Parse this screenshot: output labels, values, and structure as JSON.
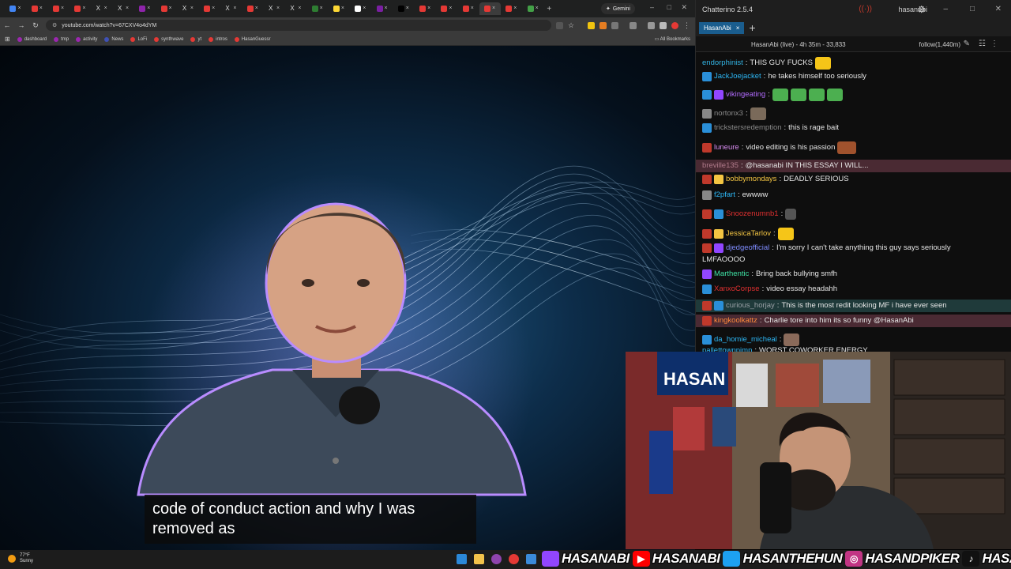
{
  "browser": {
    "tab_count": 25,
    "tabs": [
      {
        "glyph": "",
        "color": "#4285f4"
      },
      {
        "glyph": "",
        "color": "#e53935"
      },
      {
        "glyph": "",
        "color": "#e53935"
      },
      {
        "glyph": "",
        "color": "#e53935"
      },
      {
        "glyph": "X",
        "color": "#000000"
      },
      {
        "glyph": "X",
        "color": "#000000"
      },
      {
        "glyph": "",
        "color": "#8e24aa"
      },
      {
        "glyph": "",
        "color": "#e53935"
      },
      {
        "glyph": "X",
        "color": "#000000"
      },
      {
        "glyph": "",
        "color": "#e53935"
      },
      {
        "glyph": "X",
        "color": "#000000"
      },
      {
        "glyph": "",
        "color": "#e53935"
      },
      {
        "glyph": "X",
        "color": "#000000"
      },
      {
        "glyph": "X",
        "color": "#000000"
      },
      {
        "glyph": "",
        "color": "#2e7d32"
      },
      {
        "glyph": "",
        "color": "#fdd835"
      },
      {
        "glyph": "",
        "color": "#ffffff"
      },
      {
        "glyph": "",
        "color": "#7b1fa2"
      },
      {
        "glyph": "",
        "color": "#000000"
      },
      {
        "glyph": "",
        "color": "#e53935"
      },
      {
        "glyph": "",
        "color": "#e53935"
      },
      {
        "glyph": "",
        "color": "#e53935"
      },
      {
        "glyph": "",
        "color": "#e53935"
      },
      {
        "glyph": "",
        "color": "#e53935"
      },
      {
        "glyph": "",
        "color": "#43a047"
      }
    ],
    "new_tab_label": "+",
    "gemini_label": "Gemini",
    "url": "youtube.com/watch?v=67CXV4o4dYM",
    "bookmarks": [
      {
        "label": "dashboard",
        "color": "#9c27b0"
      },
      {
        "label": "tmp",
        "color": "#9c27b0"
      },
      {
        "label": "activity",
        "color": "#9c27b0"
      },
      {
        "label": "News",
        "color": "#3f51b5"
      },
      {
        "label": "LoFi",
        "color": "#e53935"
      },
      {
        "label": "synthwave",
        "color": "#e53935"
      },
      {
        "label": "yt",
        "color": "#e53935"
      },
      {
        "label": "intros",
        "color": "#e53935"
      },
      {
        "label": "HasanGuessr",
        "color": "#e53935"
      }
    ],
    "all_bookmarks_label": "All Bookmarks"
  },
  "video": {
    "caption_line1": "code of conduct action and why I was",
    "caption_line2": "removed as"
  },
  "chatterino": {
    "app_title": "Chatterino 2.5.4",
    "user": "hasanabi",
    "tab_label": "HasanAbi",
    "tab_close": "×",
    "stream_info": "HasanAbi (live) - 4h 35m - 33,833",
    "follow_label": "follow(1,440m)",
    "messages": [
      {
        "user": "endorphinist",
        "color": "#33b5e5",
        "text": "THIS GUY FUCKS",
        "badges": [],
        "emotes": [
          {
            "w": 20,
            "c": "#f5c518"
          }
        ],
        "hl": false
      },
      {
        "user": "JackJoejacket",
        "color": "#2db7f5",
        "text": "he takes himself too seriously",
        "badges": [
          "#2a8fd8"
        ],
        "emotes": [],
        "hl": false
      },
      {
        "user": "vikingeating",
        "color": "#b36cff",
        "text": "",
        "badges": [
          "#2a8fd8",
          "#9146ff"
        ],
        "emotes": [
          {
            "w": 20,
            "c": "#4caf50"
          },
          {
            "w": 20,
            "c": "#4caf50"
          },
          {
            "w": 20,
            "c": "#4caf50"
          },
          {
            "w": 20,
            "c": "#4caf50"
          }
        ],
        "hl": false
      },
      {
        "user": "nortonx3",
        "color": "#8a8a8a",
        "text": "",
        "badges": [
          "#888888"
        ],
        "emotes": [
          {
            "w": 20,
            "c": "#7a6a5a"
          }
        ],
        "hl": false
      },
      {
        "user": "trickstersredemption",
        "color": "#8a8a8a",
        "text": "this is rage bait",
        "badges": [
          "#2a8fd8"
        ],
        "emotes": [],
        "hl": false
      },
      {
        "user": "luneure",
        "color": "#d88cf0",
        "text": "video editing is his passion",
        "badges": [
          "#c0392b"
        ],
        "emotes": [
          {
            "w": 24,
            "c": "#a0522d"
          }
        ],
        "hl": false
      },
      {
        "user": "breville135",
        "color": "#b07a8a",
        "text": "@hasanabi IN THIS ESSAY I WILL...",
        "badges": [],
        "emotes": [],
        "hl": true,
        "hlcolor": "#4a2a33"
      },
      {
        "user": "bobbymondays",
        "color": "#f4c542",
        "text": "DEADLY SERIOUS",
        "badges": [
          "#c0392b",
          "#f4c542"
        ],
        "emotes": [],
        "hl": false
      },
      {
        "user": "f2pfart",
        "color": "#2db7f5",
        "text": "ewwww",
        "badges": [
          "#888888"
        ],
        "emotes": [],
        "hl": false
      },
      {
        "user": "Snoozenumnb1",
        "color": "#e03030",
        "text": "",
        "badges": [
          "#c0392b",
          "#2a8fd8"
        ],
        "emotes": [
          {
            "w": 14,
            "c": "#555555"
          }
        ],
        "hl": false
      },
      {
        "user": "JessicaTarlov",
        "color": "#f4c542",
        "text": "",
        "badges": [
          "#c0392b",
          "#f4c542"
        ],
        "emotes": [
          {
            "w": 20,
            "c": "#f5c518"
          }
        ],
        "hl": false
      },
      {
        "user": "djedgeofficial",
        "color": "#7f8cff",
        "text": "I'm sorry I can't take anything this guy says seriously",
        "text2": "LMFAOOOO",
        "badges": [
          "#c0392b",
          "#9146ff"
        ],
        "emotes": [],
        "hl": false
      },
      {
        "user": "Marthentic",
        "color": "#3fe3a5",
        "text": "Bring back bullying smfh",
        "badges": [
          "#9146ff"
        ],
        "emotes": [],
        "hl": false
      },
      {
        "user": "XanxoCorpse",
        "color": "#e03030",
        "text": "video essay headahh",
        "badges": [
          "#2a8fd8"
        ],
        "emotes": [],
        "hl": false
      },
      {
        "user": "curious_horjay",
        "color": "#9aa0a6",
        "text": "This is the most redit looking MF i have ever seen",
        "badges": [
          "#c0392b",
          "#2a8fd8"
        ],
        "emotes": [],
        "hl": true,
        "hlcolor": "#1f3a3a"
      },
      {
        "user": "kingkoolkattz",
        "color": "#ff8a3d",
        "text": "Charlie tore into him its so funny @HasanAbi",
        "badges": [
          "#c0392b"
        ],
        "emotes": [],
        "hl": true,
        "hlcolor": "#4a2a33"
      },
      {
        "user": "da_homie_micheal",
        "color": "#2db7f5",
        "text": "",
        "badges": [
          "#2a8fd8"
        ],
        "emotes": [
          {
            "w": 20,
            "c": "#8a6a5a"
          }
        ],
        "hl": false
      },
      {
        "user": "pallettownpimp",
        "color": "#2db7f5",
        "text": "WORST COWORKER ENERGY",
        "badges": [],
        "emotes": [],
        "hl": false
      }
    ]
  },
  "taskbar": {
    "weather_temp": "77°F",
    "weather_desc": "Sunny"
  },
  "socials": [
    {
      "icon": "twitch-icon",
      "glyph": "",
      "color": "#9146ff",
      "label": "HASANABI"
    },
    {
      "icon": "youtube-icon",
      "glyph": "▶",
      "color": "#ff0000",
      "label": "HASANABI"
    },
    {
      "icon": "twitter-icon",
      "glyph": "",
      "color": "#1da1f2",
      "label": "HASANTHEHUN"
    },
    {
      "icon": "instagram-icon",
      "glyph": "◎",
      "color": "#c13584",
      "label": "HASANDPIKER"
    },
    {
      "icon": "tiktok-icon",
      "glyph": "♪",
      "color": "#111111",
      "label": "HASANDPIKER"
    }
  ]
}
